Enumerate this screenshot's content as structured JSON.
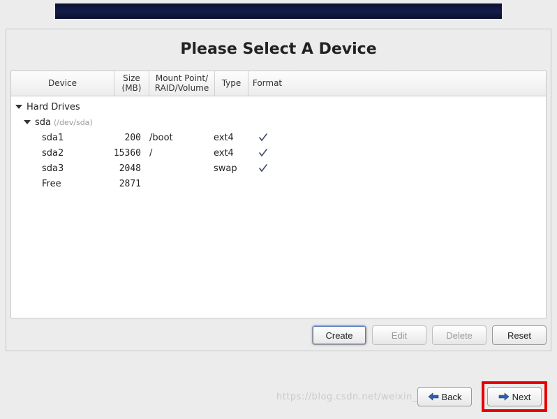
{
  "header_bar": "",
  "panel_title": "Please Select A Device",
  "columns": {
    "device": "Device",
    "size": "Size\n(MB)",
    "mount": "Mount Point/\nRAID/Volume",
    "type": "Type",
    "format": "Format"
  },
  "tree": {
    "root_label": "Hard Drives",
    "disk": {
      "name": "sda",
      "info": "(/dev/sda)"
    },
    "rows": [
      {
        "device": "sda1",
        "size": "200",
        "mount": "/boot",
        "type": "ext4",
        "format": true
      },
      {
        "device": "sda2",
        "size": "15360",
        "mount": "/",
        "type": "ext4",
        "format": true
      },
      {
        "device": "sda3",
        "size": "2048",
        "mount": "",
        "type": "swap",
        "format": true
      },
      {
        "device": "Free",
        "size": "2871",
        "mount": "",
        "type": "",
        "format": false
      }
    ]
  },
  "buttons": {
    "create": "Create",
    "edit": "Edit",
    "delete": "Delete",
    "reset": "Reset",
    "back": "Back",
    "next": "Next"
  },
  "watermark": "https://blog.csdn.net/weixin_43915798"
}
